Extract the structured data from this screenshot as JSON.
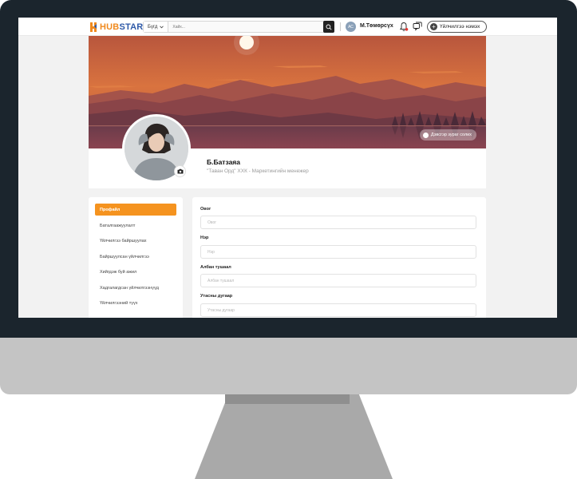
{
  "header": {
    "logo_part1": "HUB",
    "logo_part2": "STAR",
    "search_category": "Бүгд",
    "search_placeholder": "Хайх...",
    "avatar_initials": "АС",
    "user_name": "М.Төмөрсүх",
    "service_button": "Үйлчилгээ нэмэх"
  },
  "cover": {
    "change_cover_label": "Дэвсгэр зураг солих"
  },
  "profile": {
    "name": "Б.Батзаяа",
    "role": "\"Таван Орд\" ХХК - Маркетингийн менежер"
  },
  "sidebar": {
    "items": [
      {
        "label": "Профайл",
        "active": true
      },
      {
        "label": "Баталгаажуулалт",
        "active": false
      },
      {
        "label": "Үйлчилгээ байршуулах",
        "active": false
      },
      {
        "label": "Байршуулсан үйлчилгээ",
        "active": false
      },
      {
        "label": "Хийгдэж буй ажил",
        "active": false
      },
      {
        "label": "Хадгалагдсан үйлчилгээнүүд",
        "active": false
      },
      {
        "label": "Үйлчилгээний түүх",
        "active": false
      }
    ]
  },
  "form": {
    "fields": [
      {
        "label": "Овог",
        "placeholder": "Овог"
      },
      {
        "label": "Нэр",
        "placeholder": "Нэр"
      },
      {
        "label": "Албан тушаал",
        "placeholder": "Албан тушаал"
      },
      {
        "label": "Утасны дугаар",
        "placeholder": "Утасны дугаар"
      }
    ]
  },
  "colors": {
    "accent": "#f5931f",
    "bezel": "#1b252d",
    "brand_blue": "#2f5aa8"
  },
  "icons": {
    "search": "search-icon",
    "clear": "close-icon",
    "bell": "bell-icon",
    "chat": "chat-icon",
    "camera": "camera-icon",
    "plus": "plus-icon"
  }
}
